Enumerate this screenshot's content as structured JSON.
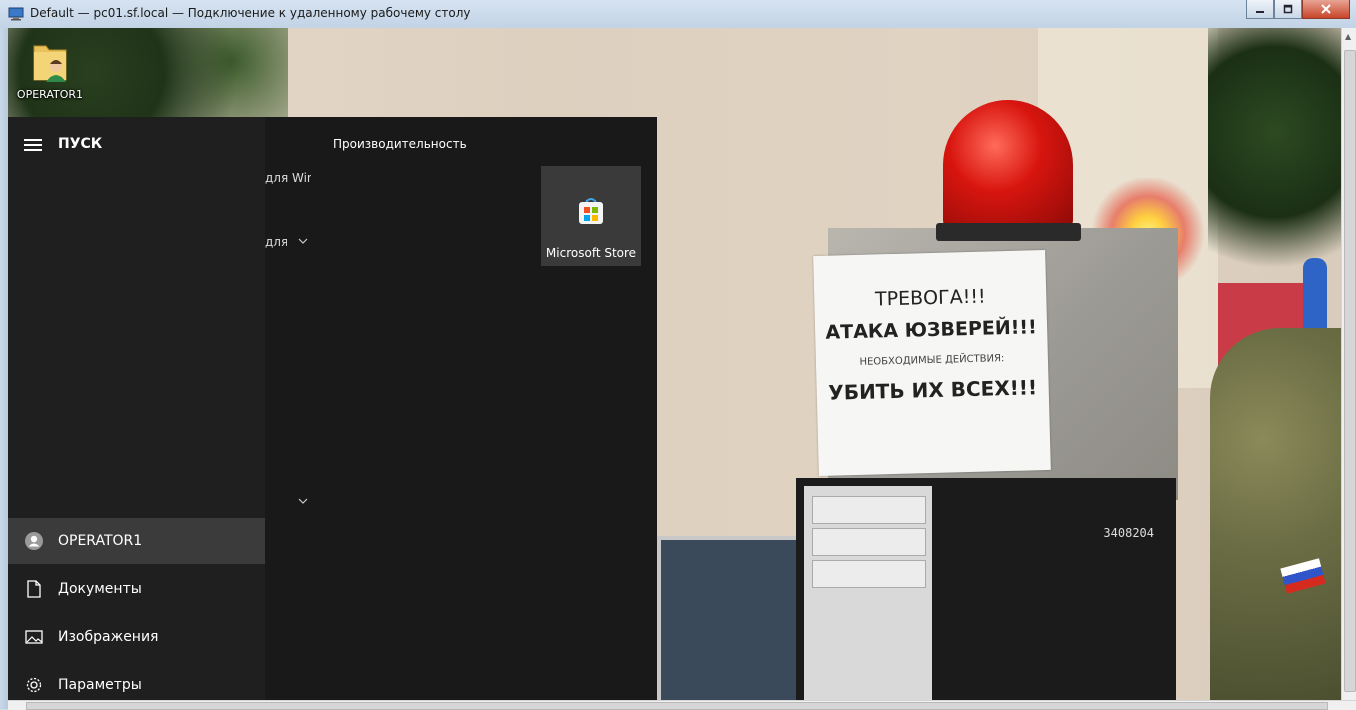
{
  "window": {
    "title": "Default — pc01.sf.local — Подключение к удаленному рабочему столу"
  },
  "desktop": {
    "icons": [
      {
        "label": "OPERATOR1",
        "icon": "user-folder-icon"
      }
    ],
    "wallpaper_sign": {
      "line1": "ТРЕВОГА!!!",
      "line2": "АТАКА ЮЗВЕРЕЙ!!!",
      "line3": "НЕОБХОДИМЫЕ ДЕЙСТВИЯ:",
      "line4": "УБИТЬ ИХ ВСЕХ!!!",
      "serial": "3408204"
    }
  },
  "start_menu": {
    "title": "ПУСК",
    "app_list_partial": [
      {
        "text": "для Win..."
      },
      {
        "text": "для..."
      }
    ],
    "tiles_group": "Производительность",
    "tiles": [
      {
        "label": "Microsoft Store",
        "icon": "microsoft-store-icon"
      }
    ],
    "nav_items": [
      {
        "label": "OPERATOR1",
        "icon": "user-icon",
        "selected": true
      },
      {
        "label": "Документы",
        "icon": "document-icon"
      },
      {
        "label": "Изображения",
        "icon": "pictures-icon"
      },
      {
        "label": "Параметры",
        "icon": "gear-icon"
      }
    ]
  },
  "colors": {
    "start_menu_bg": "#1f1f1f",
    "tiles_bg": "#191919",
    "selected_item": "#3b3b3b",
    "close_button": "#c7452b"
  }
}
